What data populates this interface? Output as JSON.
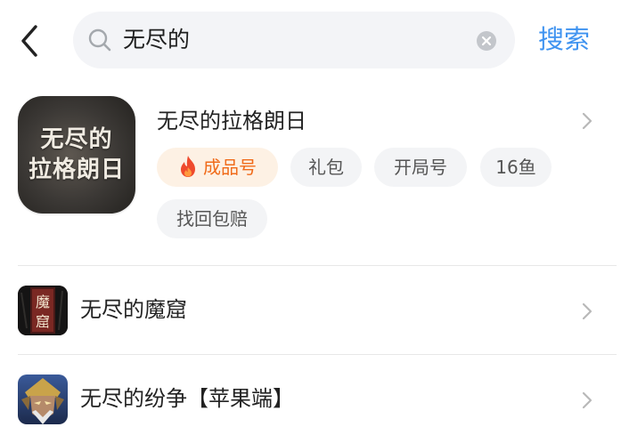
{
  "header": {
    "search_query": "无尽的",
    "search_button_label": "搜索"
  },
  "colors": {
    "accent": "#3f93f0",
    "hot_tag_text": "#f06b1a",
    "hot_tag_bg": "#fdf1e4",
    "tag_bg": "#f3f4f6"
  },
  "top_result": {
    "icon_text_line1": "无尽的",
    "icon_text_line2": "拉格朗日",
    "title": "无尽的拉格朗日",
    "tags": [
      {
        "label": "成品号",
        "icon": "fire-icon",
        "highlight": true
      },
      {
        "label": "礼包"
      },
      {
        "label": "开局号"
      },
      {
        "label": "16鱼"
      },
      {
        "label": "找回包赔"
      }
    ]
  },
  "results": [
    {
      "title": "无尽的魔窟",
      "icon_text": [
        "魔",
        "窟"
      ]
    },
    {
      "title": "无尽的纷争【苹果端】",
      "icon": "warrior-portrait-icon"
    }
  ]
}
